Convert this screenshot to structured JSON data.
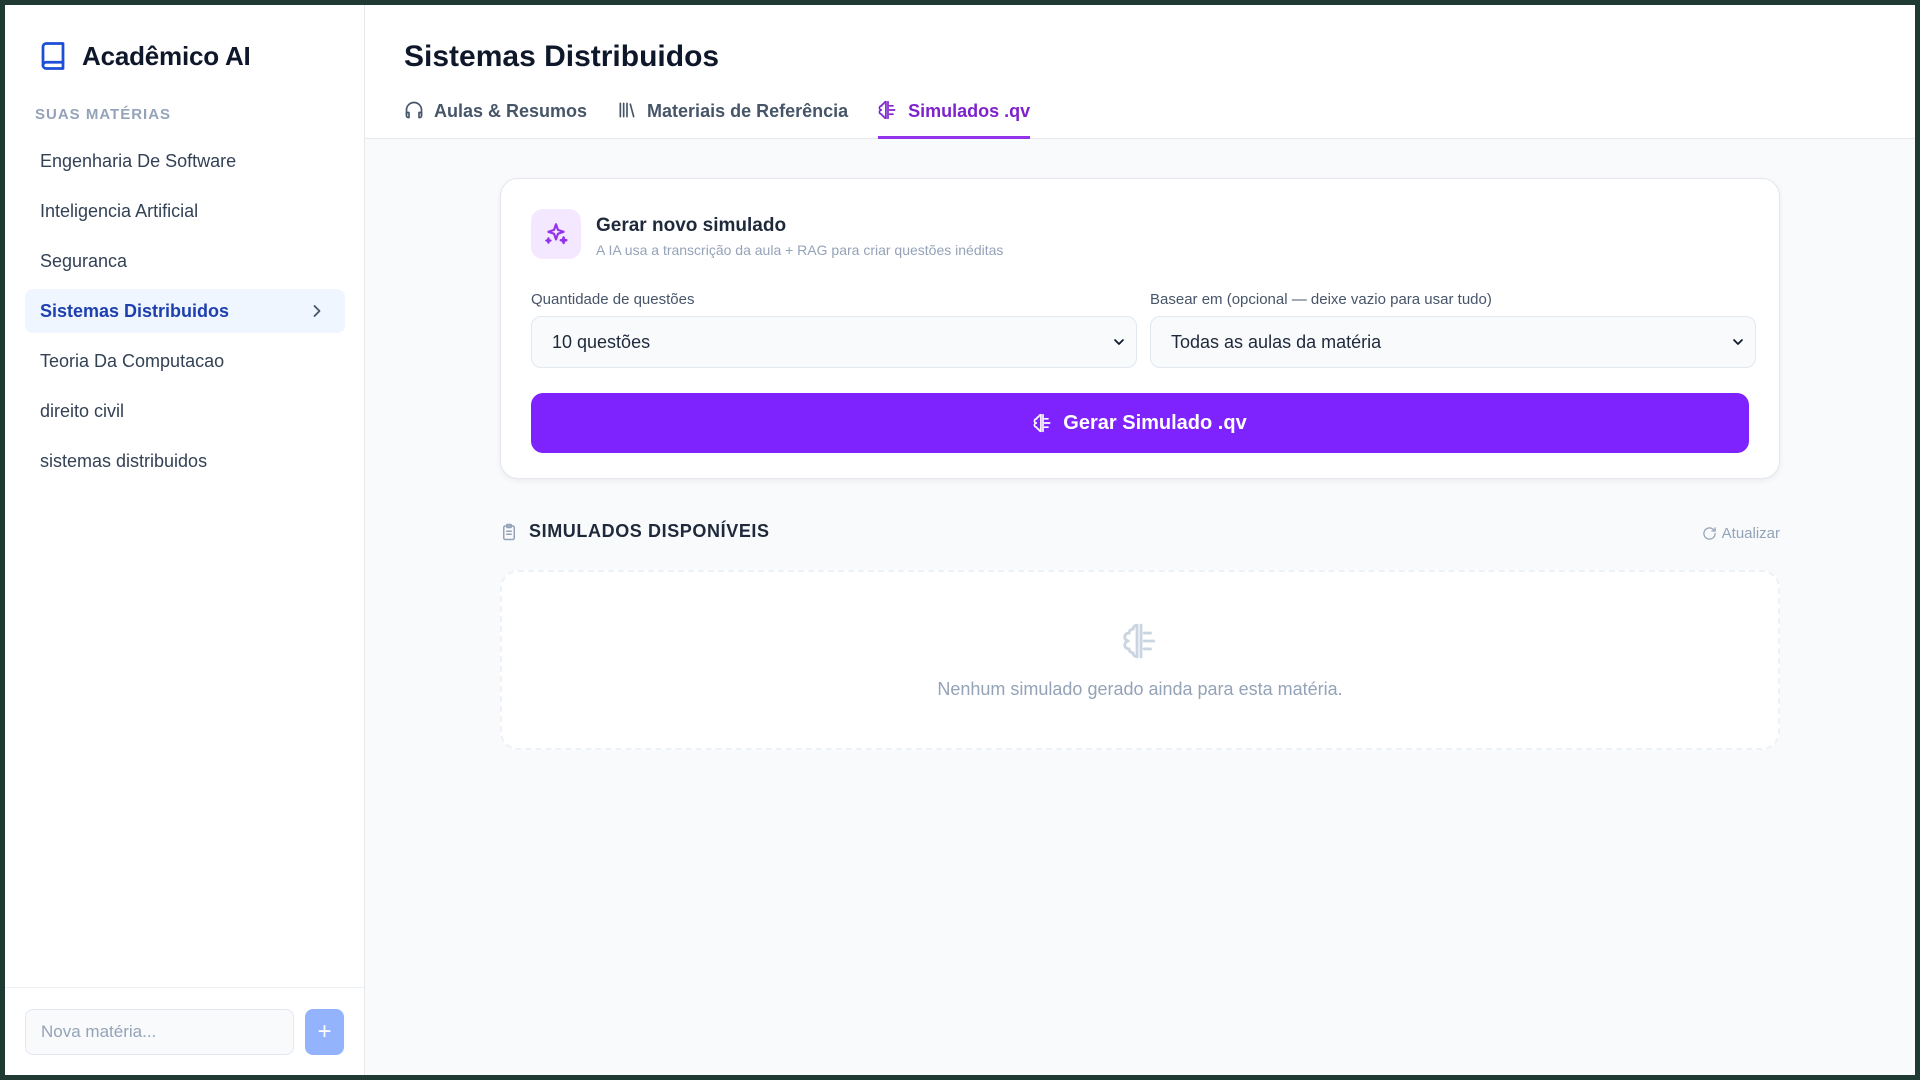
{
  "app": {
    "title": "Acadêmico AI"
  },
  "sidebar": {
    "section_label": "SUAS MATÉRIAS",
    "items": [
      {
        "label": "Engenharia De Software"
      },
      {
        "label": "Inteligencia Artificial"
      },
      {
        "label": "Seguranca"
      },
      {
        "label": "Sistemas Distribuidos",
        "active": true
      },
      {
        "label": "Teoria Da Computacao"
      },
      {
        "label": "direito civil"
      },
      {
        "label": "sistemas distribuidos"
      }
    ],
    "new_subject_placeholder": "Nova matéria...",
    "add_label": "+"
  },
  "header": {
    "title": "Sistemas Distribuidos",
    "tabs": [
      {
        "label": "Aulas & Resumos",
        "icon": "headphones-icon"
      },
      {
        "label": "Materiais de Referência",
        "icon": "library-icon"
      },
      {
        "label": "Simulados .qv",
        "icon": "brain-icon",
        "active": true
      }
    ]
  },
  "generator": {
    "title": "Gerar novo simulado",
    "subtitle": "A IA usa a transcrição da aula + RAG para criar questões inéditas",
    "quantity_label": "Quantidade de questões",
    "quantity_value": "10 questões",
    "based_on_label": "Basear em (opcional — deixe vazio para usar tudo)",
    "based_on_value": "Todas as aulas da matéria",
    "button_label": "Gerar Simulado .qv"
  },
  "list": {
    "title": "SIMULADOS DISPONÍVEIS",
    "refresh_label": "Atualizar",
    "empty_text": "Nenhum simulado gerado ainda para esta matéria."
  },
  "colors": {
    "accent": "#7e22fe",
    "active_nav_bg": "#eff6ff",
    "active_tab": "#7e22ce"
  }
}
